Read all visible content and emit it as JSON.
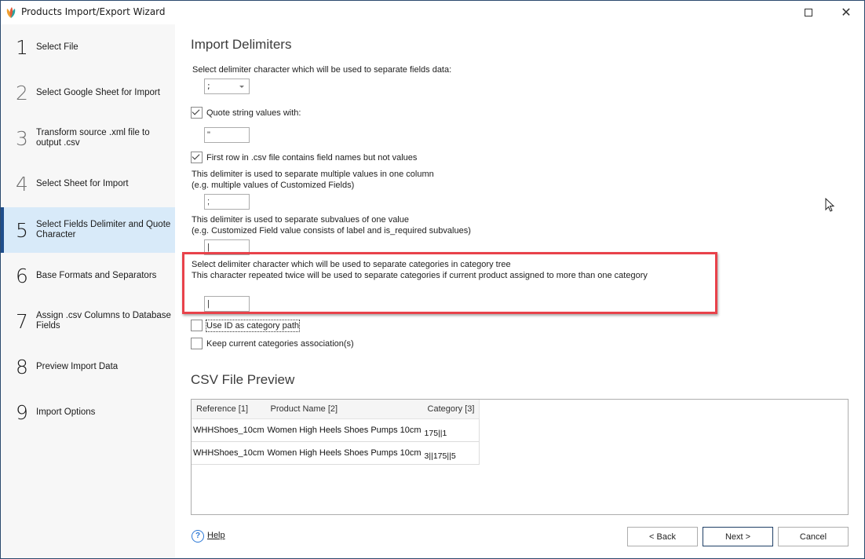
{
  "window": {
    "title": "Products Import/Export Wizard",
    "icon": "app-logo-icon",
    "controls": {
      "maximize_icon": "maximize-icon",
      "close_icon": "close-icon",
      "close_glyph": "✕"
    }
  },
  "sidebar": {
    "steps": [
      {
        "number": "1",
        "label": "Select File",
        "state": "normal"
      },
      {
        "number": "2",
        "label": "Select Google Sheet for Import",
        "state": "disabled"
      },
      {
        "number": "3",
        "label": "Transform source .xml file to output .csv",
        "state": "disabled"
      },
      {
        "number": "4",
        "label": "Select Sheet for Import",
        "state": "disabled"
      },
      {
        "number": "5",
        "label": "Select Fields Delimiter and Quote Character",
        "state": "active"
      },
      {
        "number": "6",
        "label": "Base Formats and Separators",
        "state": "normal"
      },
      {
        "number": "7",
        "label": "Assign .csv Columns to Database Fields",
        "state": "normal"
      },
      {
        "number": "8",
        "label": "Preview Import Data",
        "state": "normal"
      },
      {
        "number": "9",
        "label": "Import Options",
        "state": "normal"
      }
    ]
  },
  "import_delimiters": {
    "heading": "Import Delimiters",
    "field_delimiter": {
      "label": "Select delimiter character which will be used to separate fields data:",
      "selected": ";"
    },
    "quote_string": {
      "label": "Quote string values with:",
      "checked": true,
      "value": "\""
    },
    "first_row_names": {
      "label": "First row in .csv file contains field names but not values",
      "checked": true
    },
    "multi_value_delimiter": {
      "line1": "This delimiter is used to separate multiple values in one column",
      "line2": "(e.g. multiple values of Customized Fields)",
      "value": ";"
    },
    "subvalue_delimiter": {
      "line1": "This delimiter is used to separate subvalues of one value",
      "line2": "(e.g. Customized Field value consists of label and is_required subvalues)",
      "value": "|"
    },
    "category_delimiter": {
      "line1": "Select delimiter character which will be used to separate categories in category tree",
      "line2": "This character repeated twice will be used to separate categories if current product assigned to more than one category",
      "value": "|",
      "highlight_color": "#e8424a"
    },
    "use_id_as_category_path": {
      "label": "Use ID as category path",
      "checked": false
    },
    "keep_categories": {
      "label": "Keep current categories association(s)",
      "checked": false
    }
  },
  "csv_preview": {
    "heading": "CSV File Preview",
    "columns": [
      "Reference [1]",
      "Product Name [2]",
      "Category [3]"
    ],
    "rows": [
      [
        "WHHShoes_10cm",
        "Women High Heels Shoes Pumps 10cm",
        "175||1"
      ],
      [
        "WHHShoes_10cm",
        "Women High Heels Shoes Pumps 10cm",
        "3||175||5"
      ]
    ]
  },
  "footer": {
    "help_icon": "help-icon",
    "help_glyph": "?",
    "help_label": "Help",
    "back_label": "< Back",
    "next_label": "Next >",
    "cancel_label": "Cancel"
  },
  "colors": {
    "accent": "#1f4e8c",
    "active_step_bg": "#d8eaf9",
    "sidebar_bg": "#f7f7f7",
    "highlight": "#e8424a"
  }
}
